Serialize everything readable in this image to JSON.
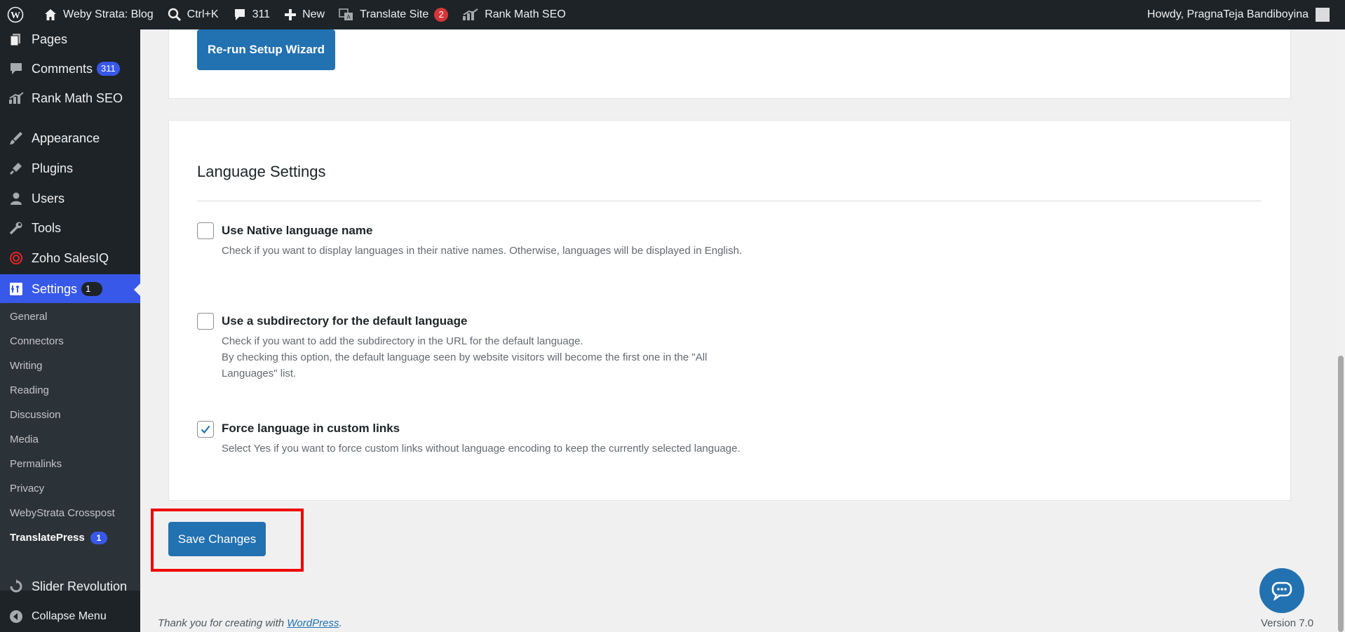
{
  "adminbar": {
    "site": "Weby Strata: Blog",
    "search_shortcut": "Ctrl+K",
    "comments_count": "311",
    "new_label": "New",
    "translate_label": "Translate Site",
    "translate_badge": "2",
    "rankmath_label": "Rank Math SEO",
    "howdy": "Howdy, PragnaTeja Bandiboyina"
  },
  "sidebar": {
    "items": [
      {
        "label": "Pages",
        "icon": "pages-icon"
      },
      {
        "label": "Comments",
        "count": "311",
        "icon": "comments-icon"
      },
      {
        "label": "Rank Math SEO",
        "icon": "rankmath-icon"
      },
      {
        "label": "Appearance",
        "icon": "appearance-icon"
      },
      {
        "label": "Plugins",
        "icon": "plugins-icon"
      },
      {
        "label": "Users",
        "icon": "users-icon"
      },
      {
        "label": "Tools",
        "icon": "tools-icon"
      },
      {
        "label": "Zoho SalesIQ",
        "icon": "zoho-icon"
      },
      {
        "label": "Settings",
        "count": "1",
        "icon": "settings-icon"
      },
      {
        "label": "Slider Revolution",
        "icon": "slider-revolution-icon"
      },
      {
        "label": "Collapse Menu",
        "icon": "collapse-icon"
      }
    ],
    "submenu": [
      {
        "label": "General"
      },
      {
        "label": "Connectors"
      },
      {
        "label": "Writing"
      },
      {
        "label": "Reading"
      },
      {
        "label": "Discussion"
      },
      {
        "label": "Media"
      },
      {
        "label": "Permalinks"
      },
      {
        "label": "Privacy"
      },
      {
        "label": "WebyStrata Crosspost"
      },
      {
        "label": "TranslatePress",
        "count": "1"
      }
    ]
  },
  "setup": {
    "rerun_label": "Re-run Setup Wizard"
  },
  "language": {
    "title": "Language Settings",
    "options": [
      {
        "label": "Use Native language name",
        "checked": false,
        "desc": "Check if you want to display languages in their native names. Otherwise, languages will be displayed in English."
      },
      {
        "label": "Use a subdirectory for the default language",
        "checked": false,
        "desc1": "Check if you want to add the subdirectory in the URL for the default language.",
        "desc2": "By checking this option, the default language seen by website visitors will become the first one in the \"All Languages\" list."
      },
      {
        "label": "Force language in custom links",
        "checked": true,
        "desc": "Select Yes if you want to force custom links without language encoding to keep the currently selected language."
      }
    ]
  },
  "save_label": "Save Changes",
  "footer": {
    "thanks_prefix": "Thank you for creating with ",
    "wp_link": "WordPress",
    "thanks_suffix": ".",
    "version": "Version 7.0"
  },
  "colors": {
    "accent": "#3858e9",
    "button": "#2271b1",
    "highlight": "#e00000"
  }
}
